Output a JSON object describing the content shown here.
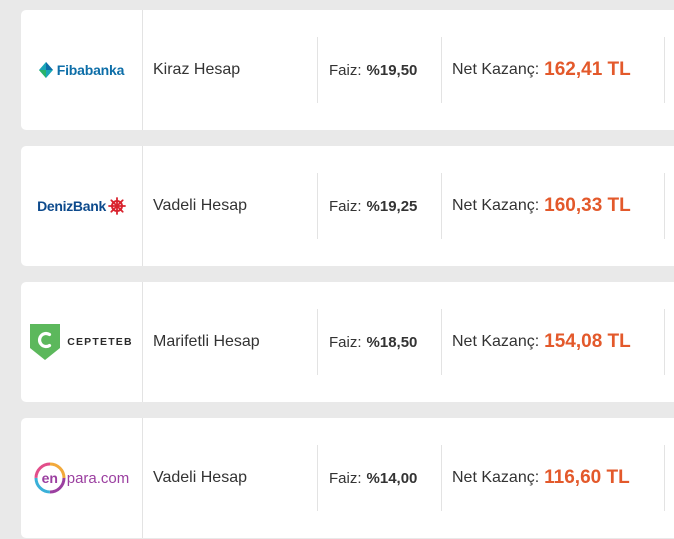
{
  "colors": {
    "accent": "#e3592b",
    "background": "#e9e9e9",
    "card": "#ffffff"
  },
  "rows": [
    {
      "bank": "Fibabanka",
      "logo_icon": "fibabanka-diamond-icon",
      "account": "Kiraz Hesap",
      "rate_label": "Faiz:",
      "rate_value": "%19,50",
      "gain_label": "Net Kazanç:",
      "gain_value": "162,41 TL"
    },
    {
      "bank": "DenizBank",
      "logo_icon": "denizbank-ship-wheel-icon",
      "account": "Vadeli Hesap",
      "rate_label": "Faiz:",
      "rate_value": "%19,25",
      "gain_label": "Net Kazanç:",
      "gain_value": "160,33 TL"
    },
    {
      "bank": "CEPTETEB",
      "logo_icon": "cepteteb-shield-icon",
      "account": "Marifetli Hesap",
      "rate_label": "Faiz:",
      "rate_value": "%18,50",
      "gain_label": "Net Kazanç:",
      "gain_value": "154,08 TL"
    },
    {
      "bank_en": "en",
      "bank_rest": "para.com",
      "logo_icon": "enpara-circle-icon",
      "account": "Vadeli Hesap",
      "rate_label": "Faiz:",
      "rate_value": "%14,00",
      "gain_label": "Net Kazanç:",
      "gain_value": "116,60 TL"
    }
  ]
}
